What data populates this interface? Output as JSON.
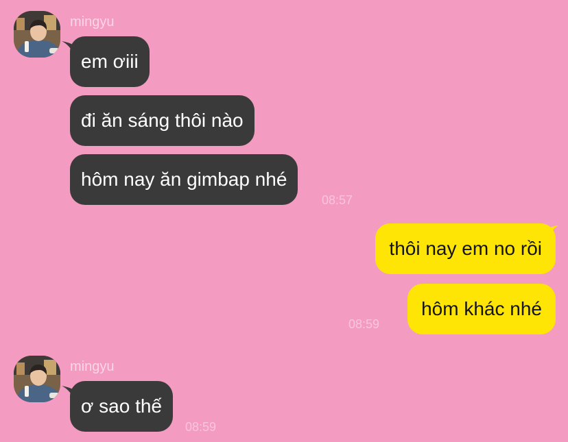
{
  "chat": {
    "contact_name": "mingyu",
    "messages": [
      {
        "from": "mingyu",
        "text": "em ơiii"
      },
      {
        "from": "mingyu",
        "text": "đi ăn sáng thôi nào"
      },
      {
        "from": "mingyu",
        "text": "hôm nay ăn gimbap nhé",
        "time": "08:57"
      },
      {
        "from": "me",
        "text": "thôi nay em no rồi"
      },
      {
        "from": "me",
        "text": "hôm khác nhé",
        "time": "08:59"
      },
      {
        "from": "mingyu",
        "text": "ơ sao thế",
        "time": "08:59"
      }
    ]
  },
  "colors": {
    "background": "#f49bc2",
    "incoming_bubble": "#3b3a3b",
    "outgoing_bubble": "#ffe505",
    "name_text": "#fbd6e6",
    "timestamp_text": "#f8c6dc"
  },
  "icons": {
    "avatar": "profile-photo"
  }
}
